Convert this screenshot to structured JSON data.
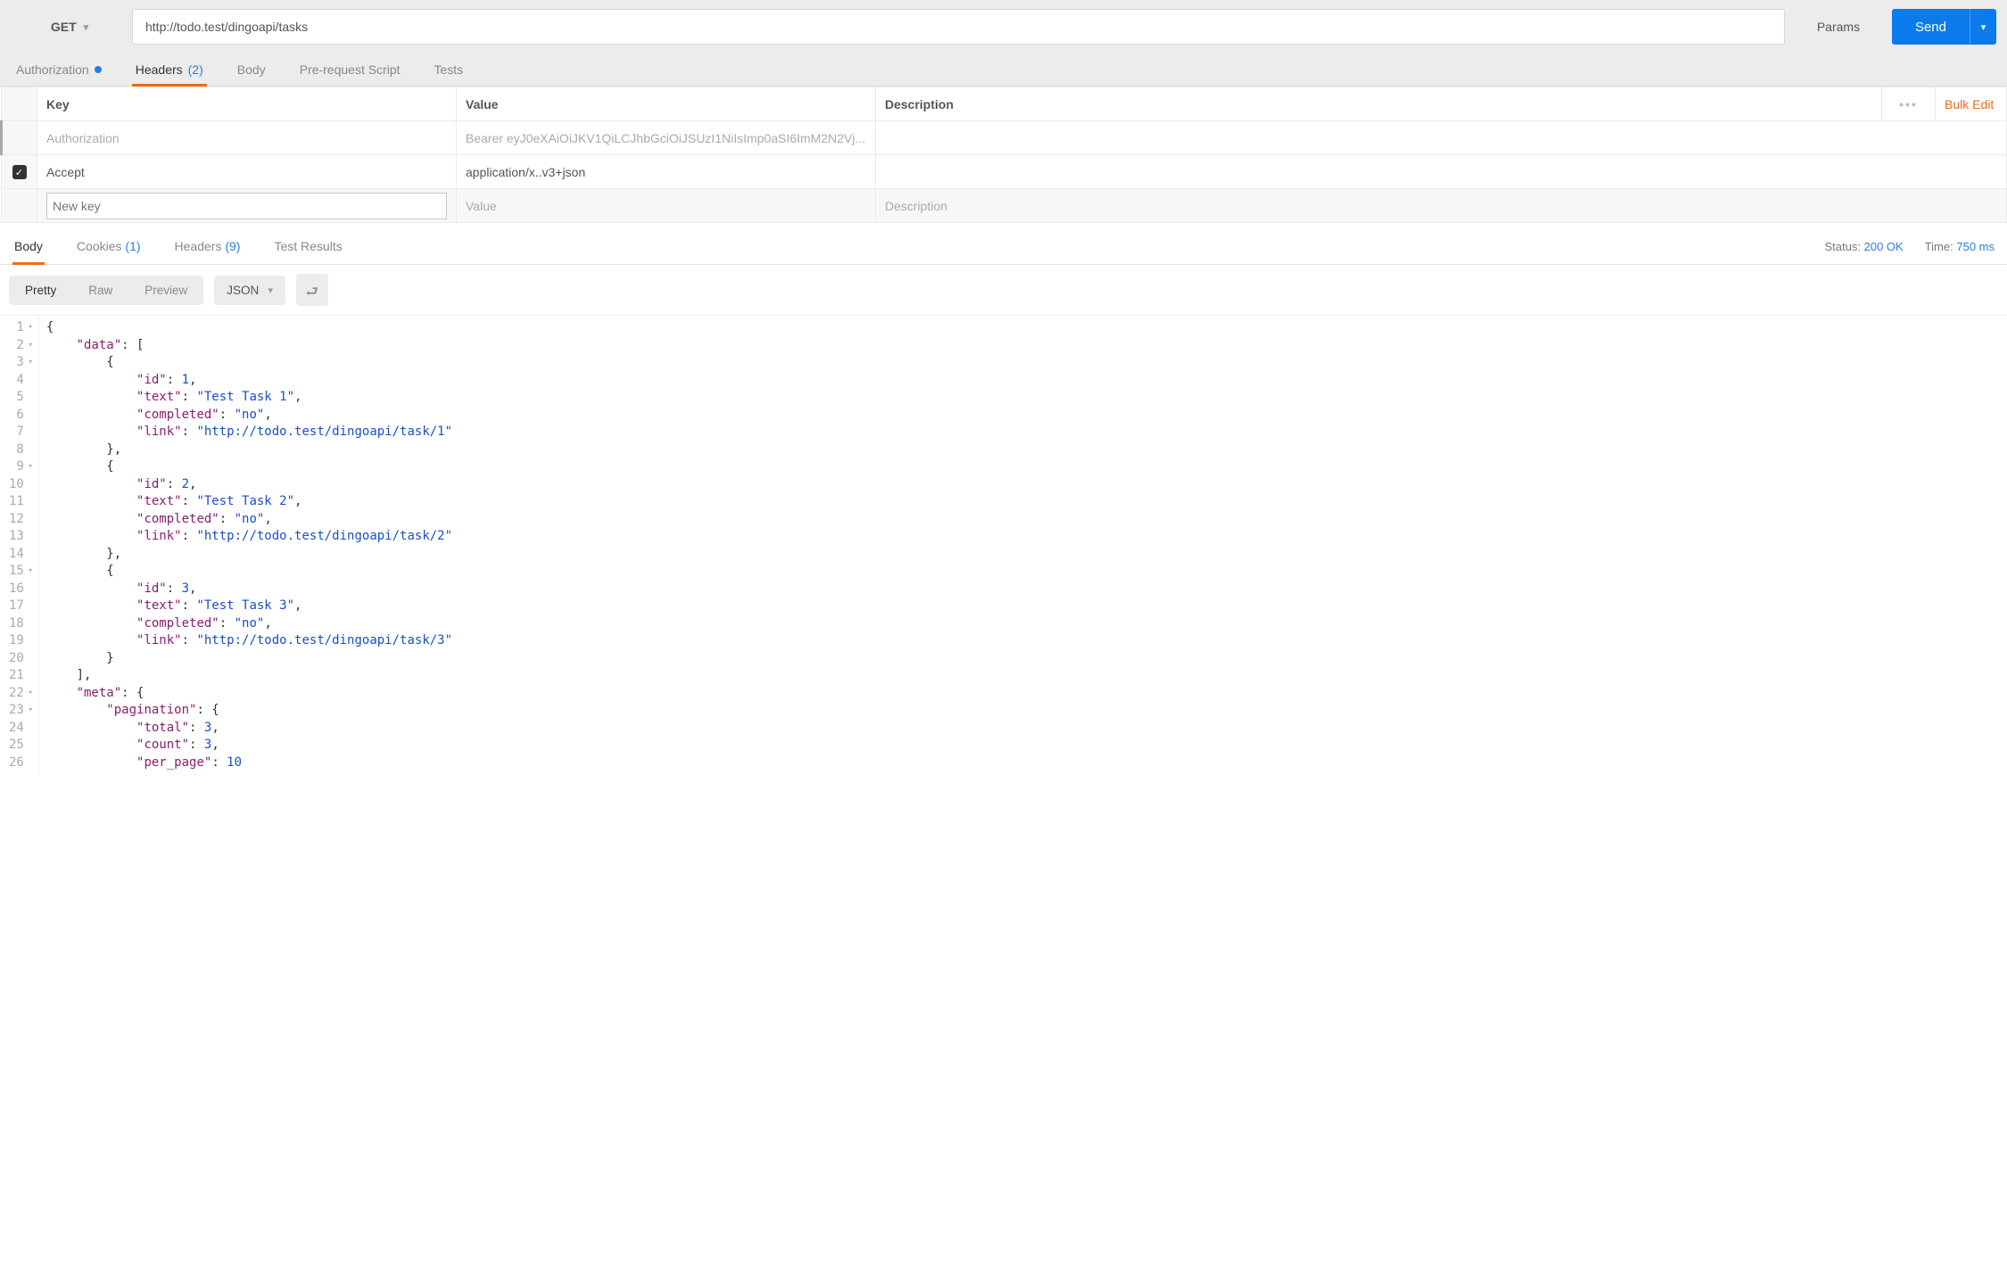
{
  "request": {
    "method": "GET",
    "url": "http://todo.test/dingoapi/tasks",
    "params_label": "Params",
    "send_label": "Send"
  },
  "req_tabs": {
    "authorization": "Authorization",
    "headers": "Headers",
    "headers_count": "(2)",
    "body": "Body",
    "prerequest": "Pre-request Script",
    "tests": "Tests"
  },
  "headers_table": {
    "col_key": "Key",
    "col_value": "Value",
    "col_desc": "Description",
    "bulk_edit": "Bulk Edit",
    "rows": [
      {
        "checked": false,
        "key": "Authorization",
        "value": "Bearer eyJ0eXAiOiJKV1QiLCJhbGciOiJSUzI1NiIsImp0aSI6ImM2N2Vj...",
        "desc": ""
      },
      {
        "checked": true,
        "key": "Accept",
        "value": "application/x..v3+json",
        "desc": ""
      }
    ],
    "new_key_placeholder": "New key",
    "new_value_placeholder": "Value",
    "new_desc_placeholder": "Description"
  },
  "resp_tabs": {
    "body": "Body",
    "cookies": "Cookies",
    "cookies_count": "(1)",
    "headers": "Headers",
    "headers_count": "(9)",
    "test_results": "Test Results"
  },
  "resp_meta": {
    "status_label": "Status:",
    "status_value": "200 OK",
    "time_label": "Time:",
    "time_value": "750 ms"
  },
  "resp_toolbar": {
    "pretty": "Pretty",
    "raw": "Raw",
    "preview": "Preview",
    "format": "JSON"
  },
  "response_body": {
    "data": [
      {
        "id": 1,
        "text": "Test Task 1",
        "completed": "no",
        "link": "http://todo.test/dingoapi/task/1"
      },
      {
        "id": 2,
        "text": "Test Task 2",
        "completed": "no",
        "link": "http://todo.test/dingoapi/task/2"
      },
      {
        "id": 3,
        "text": "Test Task 3",
        "completed": "no",
        "link": "http://todo.test/dingoapi/task/3"
      }
    ],
    "meta": {
      "pagination": {
        "total": 3,
        "count": 3,
        "per_page": 10
      }
    }
  }
}
